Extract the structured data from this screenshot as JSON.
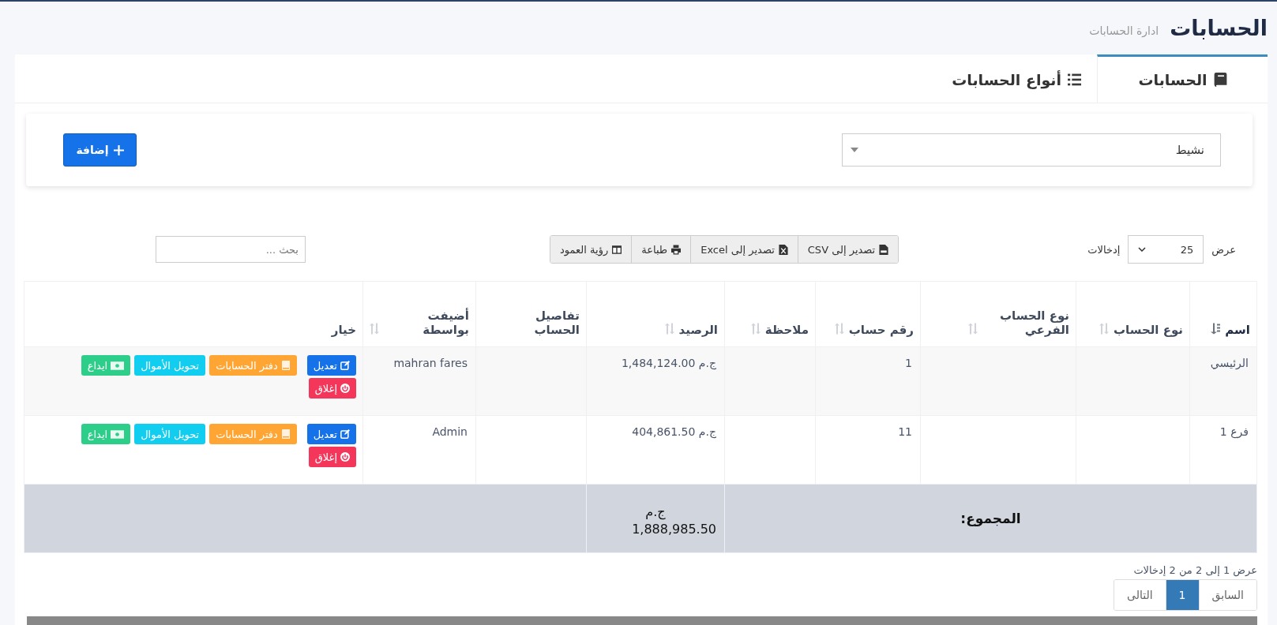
{
  "header": {
    "title": "الحسابات",
    "subtitle": "ادارة الحسابات"
  },
  "tabs": [
    {
      "label": "الحسابات",
      "selected": true
    },
    {
      "label": "أنواع الحسابات",
      "selected": false
    }
  ],
  "filter": {
    "status": "نشيط",
    "add_button": "إضافة"
  },
  "length": {
    "show": "عرض",
    "value": "25",
    "entries": "إدخالات"
  },
  "export_buttons": [
    "تصدير إلى CSV",
    "تصدير إلى Excel",
    "طباعة",
    "رؤية العمود"
  ],
  "search": {
    "placeholder": "بحث ..."
  },
  "table": {
    "columns": [
      {
        "label": "اسم",
        "sortable": true,
        "sorted": true
      },
      {
        "label": "نوع الحساب",
        "sortable": true,
        "sorted": false
      },
      {
        "label": "نوع الحساب الفرعي",
        "sortable": true,
        "sorted": false
      },
      {
        "label": "رقم حساب",
        "sortable": true,
        "sorted": false
      },
      {
        "label": "ملاحظة",
        "sortable": true,
        "sorted": false
      },
      {
        "label": "الرصيد",
        "sortable": true,
        "sorted": false
      },
      {
        "label": "تفاصيل الحساب",
        "sortable": false,
        "sorted": false
      },
      {
        "label": "أضيفت بواسطة",
        "sortable": true,
        "sorted": false
      },
      {
        "label": "خيار",
        "sortable": false,
        "sorted": false
      }
    ],
    "rows": [
      {
        "name": "الرئيسي",
        "number": "1",
        "balance": "ج.م 1,484,124.00",
        "added_by": "mahran fares",
        "actions": [
          {
            "label": "تعديل",
            "color": "#1572e8"
          },
          {
            "label": "دفتر الحسابات",
            "color": "#ffa534"
          },
          {
            "label": "تحويل الأموال",
            "color": "#11cdef"
          },
          {
            "label": "ايداع",
            "color": "#2dce89"
          },
          {
            "label": "إغلاق",
            "color": "#f3365a"
          }
        ]
      },
      {
        "name": "فرع 1",
        "number": "11",
        "balance": "ج.م 404,861.50",
        "added_by": "Admin",
        "actions": [
          {
            "label": "تعديل",
            "color": "#1572e8"
          },
          {
            "label": "دفتر الحسابات",
            "color": "#ffa534"
          },
          {
            "label": "تحويل الأموال",
            "color": "#11cdef"
          },
          {
            "label": "ايداع",
            "color": "#2dce89"
          },
          {
            "label": "إغلاق",
            "color": "#f3365a"
          }
        ]
      }
    ],
    "total": {
      "label": "المجموع:",
      "currency": "ج.م",
      "amount": "1,888,985.50"
    }
  },
  "info": "عرض 1 إلى 2 من 2 إدخالات",
  "pagination": [
    {
      "label": "السابق",
      "selected": false
    },
    {
      "label": "1",
      "selected": true
    },
    {
      "label": "التالى",
      "selected": false
    }
  ]
}
